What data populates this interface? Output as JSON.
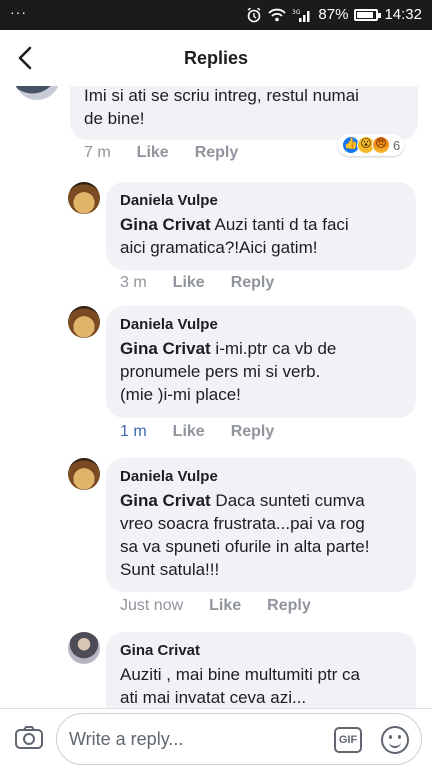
{
  "status_bar": {
    "left": "···",
    "battery_percent": "87%",
    "time": "14:32",
    "battery_level": 0.87
  },
  "header": {
    "title": "Replies"
  },
  "top_comment": {
    "text": "Imi si ati se scriu intreg, restul numai\nde bine!",
    "time": "7 m",
    "like_label": "Like",
    "reply_label": "Reply",
    "reactions": [
      "like",
      "wow",
      "angry"
    ],
    "reaction_count": "6"
  },
  "replies": [
    {
      "author": "Daniela Vulpe",
      "mention": "Gina Crivat",
      "text": " Auzi tanti d ta faci\naici gramatica?!Aici gatim!",
      "time": "3 m",
      "like_label": "Like",
      "reply_label": "Reply"
    },
    {
      "author": "Daniela Vulpe",
      "mention": "Gina Crivat",
      "text": " i-mi.ptr ca vb de\npronumele pers mi si verb.\n(mie )i-mi place!",
      "time": "1 m",
      "like_label": "Like",
      "reply_label": "Reply"
    },
    {
      "author": "Daniela Vulpe",
      "mention": "Gina Crivat",
      "text": " Daca sunteti cumva\nvreo soacra frustrata...pai va rog\nsa va spuneti ofurile in alta parte!\nSunt satula!!!",
      "time": "Just now",
      "like_label": "Like",
      "reply_label": "Reply"
    },
    {
      "author": "Gina Crivat",
      "text": "Auziti ,  mai bine multumiti ptr ca\nati mai invatat ceva azi..."
    }
  ],
  "composer": {
    "placeholder": "Write a reply...",
    "gif_label": "GIF"
  },
  "colors": {
    "bubble": "#f0f2f5",
    "meta": "#90949c",
    "accent": "#4267b2"
  }
}
